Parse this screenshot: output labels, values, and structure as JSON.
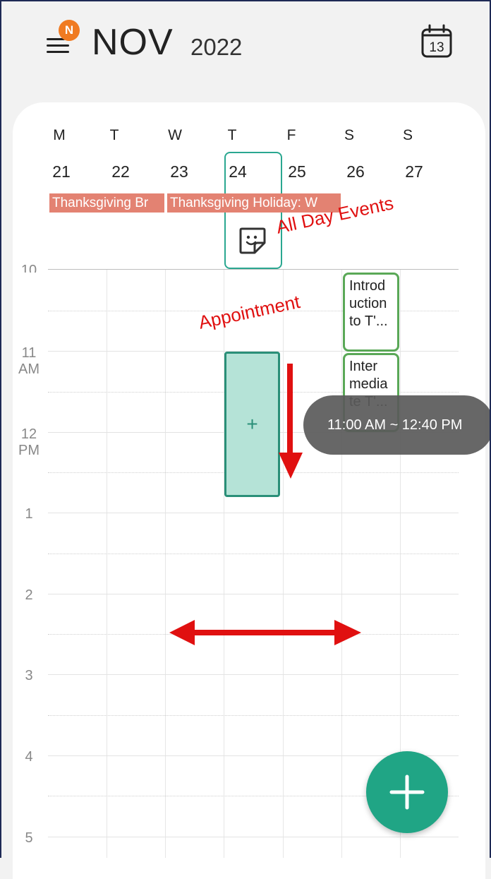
{
  "header": {
    "menu_badge": "N",
    "month": "NOV",
    "year": "2022",
    "today_icon_day": "13"
  },
  "week": {
    "days": [
      {
        "letter": "M",
        "date": "21"
      },
      {
        "letter": "T",
        "date": "22"
      },
      {
        "letter": "W",
        "date": "23"
      },
      {
        "letter": "T",
        "date": "24"
      },
      {
        "letter": "F",
        "date": "25"
      },
      {
        "letter": "S",
        "date": "26"
      },
      {
        "letter": "S",
        "date": "27"
      }
    ],
    "selected_date": "24"
  },
  "all_day_events": [
    {
      "title": "Thanksgiving Br",
      "color": "#e38272"
    },
    {
      "title": "Thanksgiving Holiday: W",
      "color": "#e38272"
    }
  ],
  "hour_labels": [
    {
      "hour": "10",
      "ampm": ""
    },
    {
      "hour": "11",
      "ampm": "AM"
    },
    {
      "hour": "12",
      "ampm": "PM"
    },
    {
      "hour": "1",
      "ampm": ""
    },
    {
      "hour": "2",
      "ampm": ""
    },
    {
      "hour": "3",
      "ampm": ""
    },
    {
      "hour": "4",
      "ampm": ""
    },
    {
      "hour": "5",
      "ampm": ""
    }
  ],
  "events": [
    {
      "title": "Introd uction to T'...",
      "color": "#5aa857"
    },
    {
      "title": "Inter media te T'...",
      "color": "#5aa857"
    }
  ],
  "new_appointment": {
    "plus": "+",
    "time_range": "11:00 AM ~ 12:40 PM"
  },
  "annotations": {
    "all_day_label": "All Day Events",
    "appointment_label": "Appointment",
    "color": "#e01010"
  },
  "colors": {
    "accent": "#20a585",
    "badge": "#f07b22",
    "holiday": "#e38272",
    "event_border": "#5aa857"
  }
}
